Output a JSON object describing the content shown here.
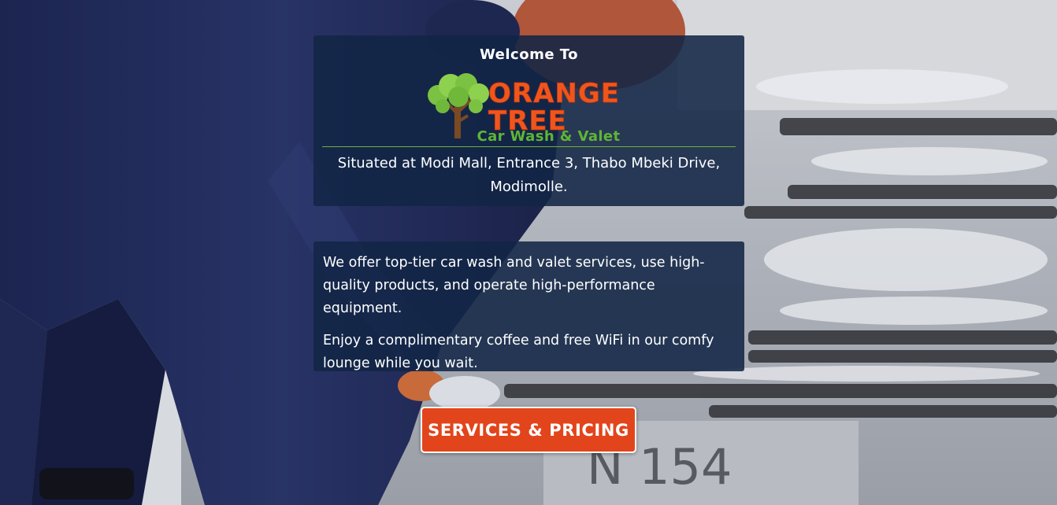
{
  "hero": {
    "welcome": "Welcome To",
    "logo": {
      "line1": "ORANGE",
      "line2": "TREE",
      "tagline": "Car Wash & Valet",
      "icon": "tree-icon"
    },
    "address": "Situated at Modi Mall, Entrance 3, Thabo Mbeki Drive, Modimolle."
  },
  "info": {
    "paragraph1": "We offer top-tier car wash and valet services, use high-quality products, and operate high-performance equipment.",
    "paragraph2": "Enjoy a complimentary coffee and free WiFi in our comfy lounge while you wait."
  },
  "cta": {
    "label": "SERVICES & PRICING"
  },
  "colors": {
    "panel": "#122646",
    "brand_orange": "#f0561c",
    "brand_green": "#5fb535",
    "button": "#e2451b"
  }
}
